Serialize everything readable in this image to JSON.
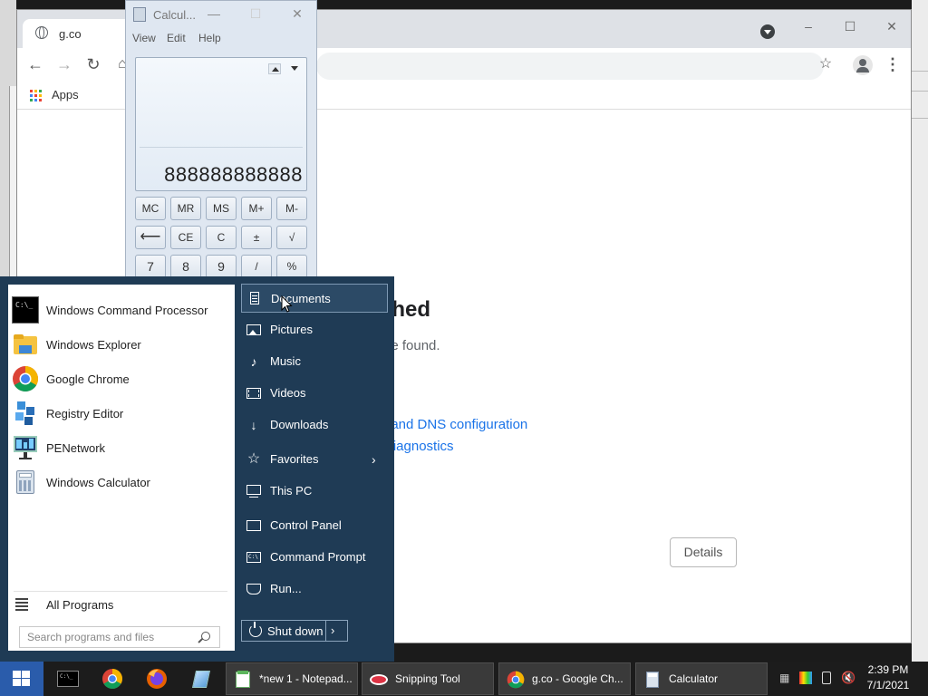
{
  "chrome": {
    "tab_title": "g.co",
    "bookmarks_apps": "Apps",
    "error_title_fragment": "ched",
    "error_sub_fragment": "be found.",
    "link_dns": ", and DNS configuration",
    "link_diag": "Diagnostics",
    "details_label": "Details",
    "controls": {
      "minimize": "–",
      "maximize": "☐",
      "close": "✕"
    }
  },
  "calculator": {
    "title": "Calcul...",
    "menu": [
      "View",
      "Edit",
      "Help"
    ],
    "display": "888888888888",
    "buttons": {
      "r1": [
        "MC",
        "MR",
        "MS",
        "M+",
        "M-"
      ],
      "r2": [
        "⟵",
        "CE",
        "C",
        "±",
        "√"
      ],
      "r3": [
        "7",
        "8",
        "9",
        "/",
        "%"
      ]
    },
    "controls": {
      "minimize": "—",
      "maximize": "☐",
      "close": "✕"
    }
  },
  "start_menu": {
    "programs": [
      {
        "label": "Windows Command Processor",
        "icon": "cmd-icon"
      },
      {
        "label": "Windows Explorer",
        "icon": "folder-icon"
      },
      {
        "label": "Google Chrome",
        "icon": "chrome-icon"
      },
      {
        "label": "Registry Editor",
        "icon": "registry-icon"
      },
      {
        "label": "PENetwork",
        "icon": "network-icon"
      },
      {
        "label": "Windows Calculator",
        "icon": "calculator-icon"
      }
    ],
    "all_programs": "All Programs",
    "search_placeholder": "Search programs and files",
    "right_items": [
      {
        "label": "Documents",
        "icon": "document-icon"
      },
      {
        "label": "Pictures",
        "icon": "picture-icon"
      },
      {
        "label": "Music",
        "icon": "music-icon"
      },
      {
        "label": "Videos",
        "icon": "video-icon"
      },
      {
        "label": "Downloads",
        "icon": "download-icon"
      },
      {
        "label": "Favorites",
        "icon": "star-icon"
      },
      {
        "label": "This PC",
        "icon": "computer-icon"
      },
      {
        "label": "Control Panel",
        "icon": "control-panel-icon"
      },
      {
        "label": "Command Prompt",
        "icon": "cmd-icon"
      },
      {
        "label": "Run...",
        "icon": "run-icon"
      }
    ],
    "shutdown": "Shut down"
  },
  "taskbar": {
    "tasks": [
      {
        "label": "*new 1 - Notepad...",
        "icon": "notepad-icon"
      },
      {
        "label": "Snipping Tool",
        "icon": "snipping-icon"
      },
      {
        "label": "g.co - Google Ch...",
        "icon": "chrome-icon"
      },
      {
        "label": "Calculator",
        "icon": "calculator-icon"
      }
    ],
    "time": "2:39 PM",
    "date": "7/1/2021"
  },
  "colors": {
    "start_menu_bg": "#1f3b55",
    "taskbar_bg": "#1c1c1c",
    "link": "#1a73e8",
    "start_button": "#2a5cab"
  }
}
